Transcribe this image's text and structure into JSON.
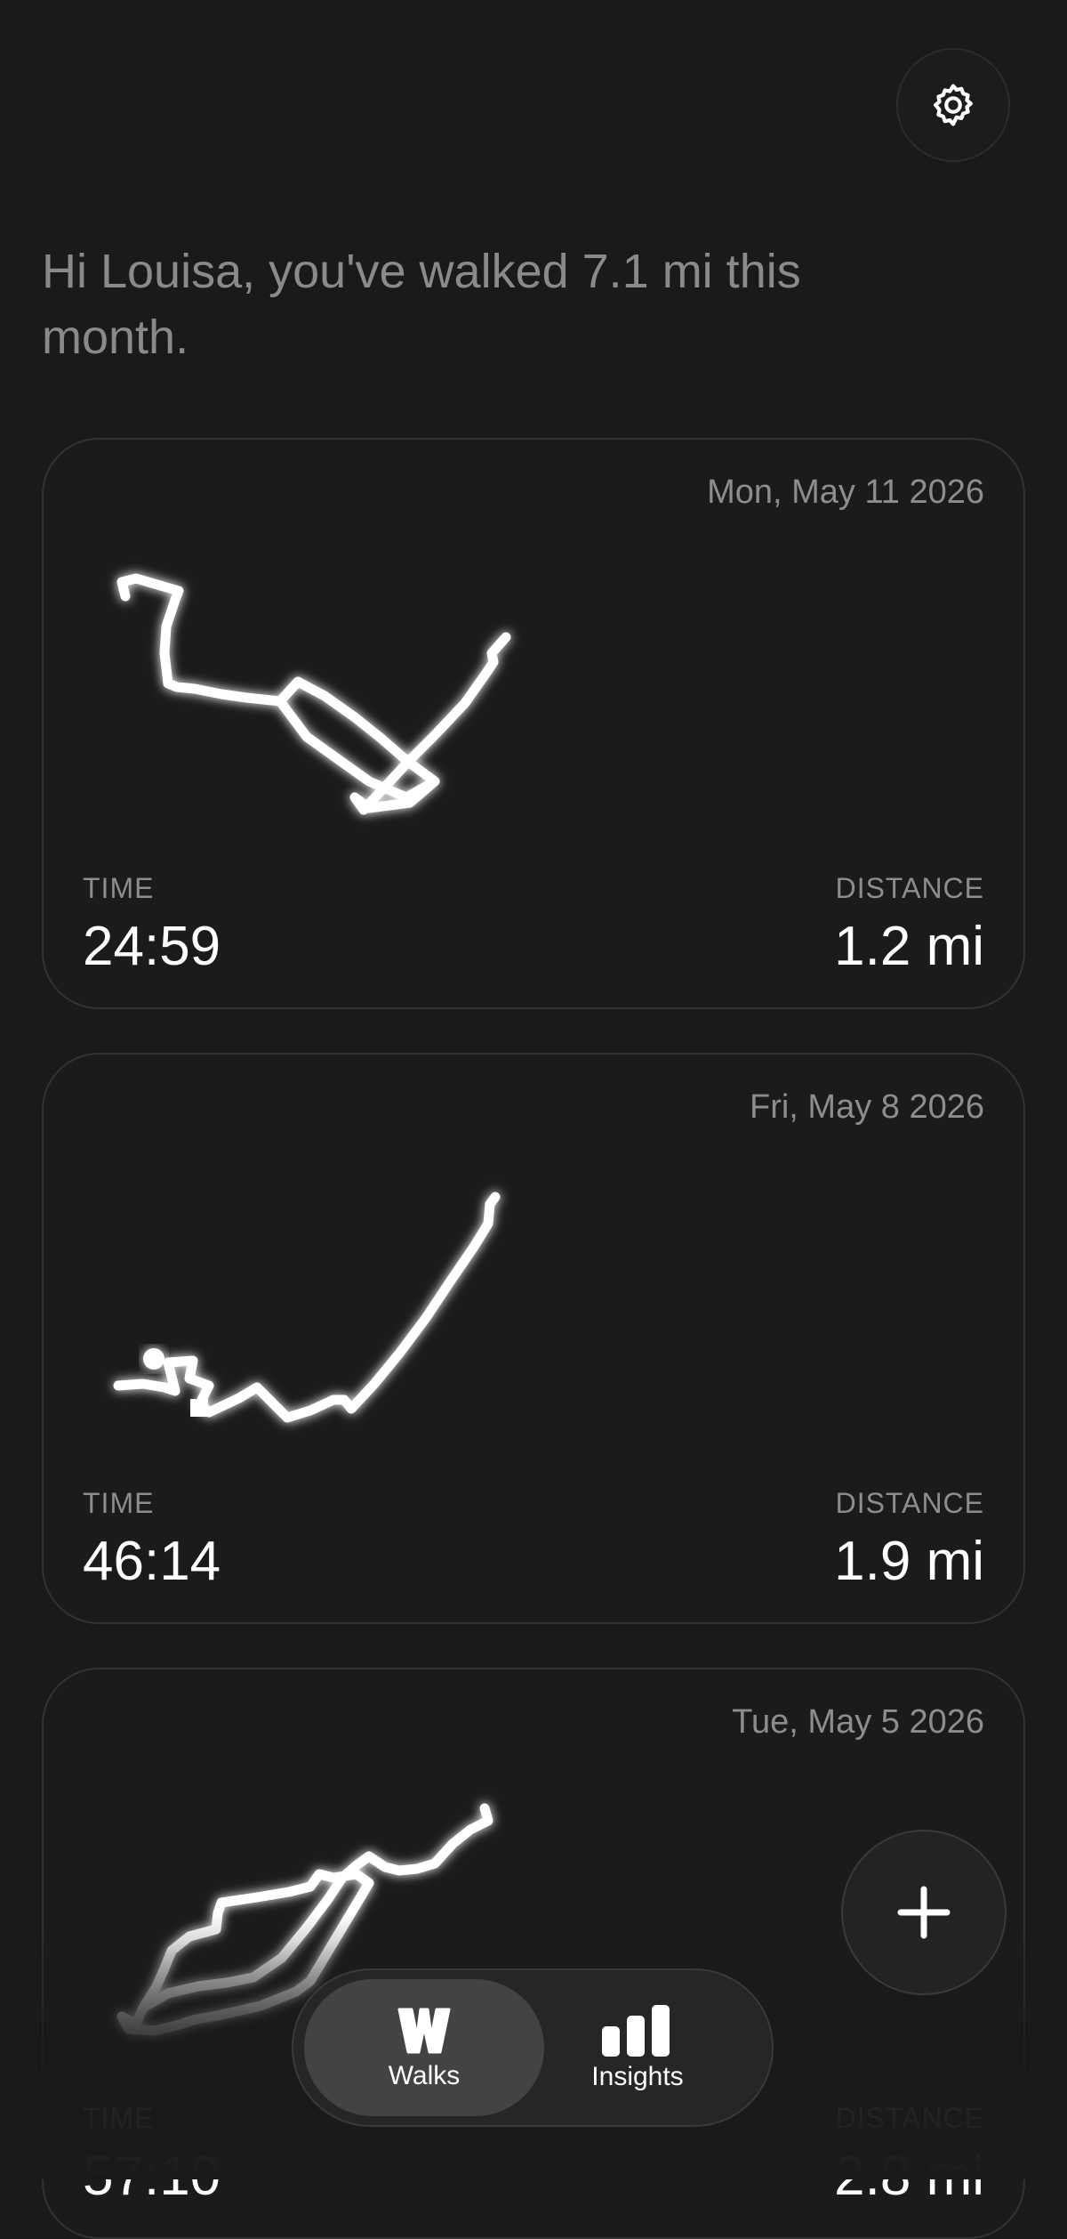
{
  "header": {
    "greeting": "Hi Louisa, you've walked 7.1 mi this month.",
    "settings_icon": "gear-icon"
  },
  "walks": [
    {
      "date": "Mon, May 11 2026",
      "time_label": "TIME",
      "time": "24:59",
      "distance_label": "DISTANCE",
      "distance": "1.2 mi"
    },
    {
      "date": "Fri, May 8 2026",
      "time_label": "TIME",
      "time": "46:14",
      "distance_label": "DISTANCE",
      "distance": "1.9 mi"
    },
    {
      "date": "Tue, May 5 2026",
      "time_label": "TIME",
      "time": "57:10",
      "distance_label": "DISTANCE",
      "distance": "2.8 mi"
    }
  ],
  "tabbar": {
    "walks_label": "Walks",
    "insights_label": "Insights",
    "walks_icon": "walks-w-icon",
    "insights_icon": "bar-chart-icon"
  },
  "fab": {
    "icon": "plus-icon"
  },
  "colors": {
    "background": "#1a1a1a",
    "card": "#1b1b1b",
    "route": "#ffffff",
    "muted_text": "#8d8d8d"
  }
}
